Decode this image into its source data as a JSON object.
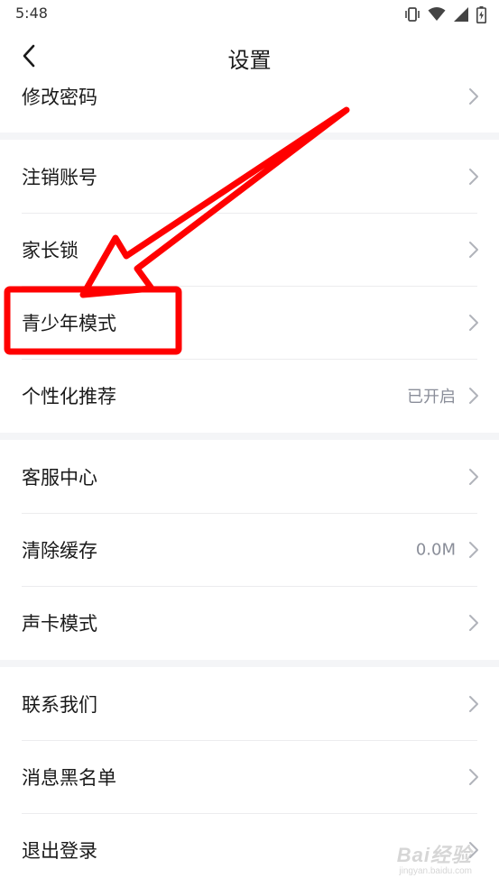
{
  "status_bar": {
    "time": "5:48",
    "icons": [
      "vibrate-icon",
      "wifi-icon",
      "signal-icon",
      "battery-charging-icon"
    ]
  },
  "nav": {
    "title": "设置",
    "back_icon": "chevron-left-icon"
  },
  "rows": [
    {
      "label": "修改密码",
      "value": ""
    },
    {
      "label": "注销账号",
      "value": ""
    },
    {
      "label": "家长锁",
      "value": ""
    },
    {
      "label": "青少年模式",
      "value": ""
    },
    {
      "label": "个性化推荐",
      "value": "已开启"
    },
    {
      "label": "客服中心",
      "value": ""
    },
    {
      "label": "清除缓存",
      "value": "0.0M"
    },
    {
      "label": "声卡模式",
      "value": ""
    },
    {
      "label": "联系我们",
      "value": ""
    },
    {
      "label": "消息黑名单",
      "value": ""
    },
    {
      "label": "退出登录",
      "value": ""
    }
  ],
  "annotation": {
    "highlight_color": "#ff0000",
    "highlight_target": "青少年模式"
  },
  "watermark": {
    "logo": "Bai经验",
    "sub": "jingyan.baidu.com"
  },
  "colors": {
    "text_primary": "#1a1a1a",
    "text_secondary": "#8a8e99",
    "chevron": "#b0b3ba",
    "section_gap": "#f4f5f7",
    "divider": "#ececee"
  }
}
